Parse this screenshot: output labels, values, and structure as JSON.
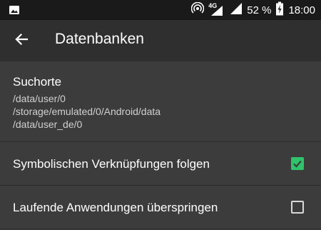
{
  "status_bar": {
    "battery_percent": "52 %",
    "time": "18:00",
    "network_type": "4G",
    "icons": [
      "image-icon",
      "hotspot-icon",
      "signal-icon",
      "battery-charging-icon"
    ]
  },
  "app_bar": {
    "title": "Datenbanken",
    "back_icon": "arrow-back-icon"
  },
  "search_paths": {
    "title": "Suchorte",
    "paths": [
      "/data/user/0",
      "/storage/emulated/0/Android/data",
      "/data/user_de/0"
    ]
  },
  "preferences": [
    {
      "label": "Symbolischen Verknüpfungen folgen",
      "checked": true
    },
    {
      "label": "Laufende Anwendungen überspringen",
      "checked": false
    }
  ],
  "colors": {
    "accent": "#2fc36b",
    "background": "#3c3c3c",
    "app_bar": "#2f2f2f",
    "status_bar": "#1a1a1a"
  }
}
